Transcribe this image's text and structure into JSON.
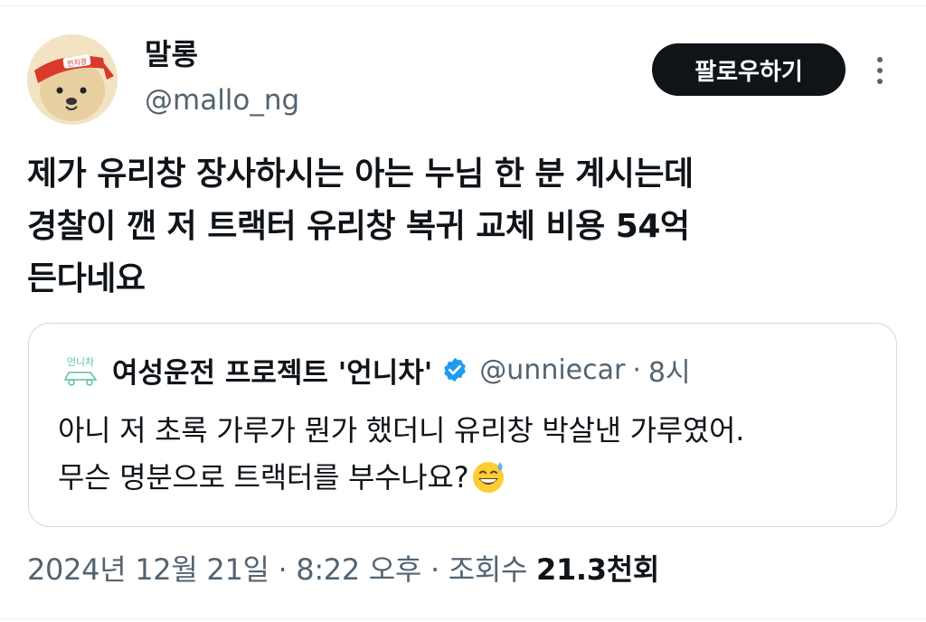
{
  "author": {
    "name": "말롱",
    "handle": "@mallo_ng",
    "avatar_badge_text": "먼지킁"
  },
  "follow_button_label": "팔로우하기",
  "tweet": {
    "lines": [
      "제가 유리창 장사하시는 아는 누님 한 분 계시는데",
      "경찰이 깬 저 트랙터 유리창 복귀 교체 비용 54억",
      "든다네요"
    ]
  },
  "quote": {
    "avatar_text": "언니차",
    "name": "여성운전 프로젝트 '언니차'",
    "handle": "@unniecar",
    "separator": "·",
    "time": "8시",
    "lines": [
      "아니 저 초록 가루가 뭔가 했더니 유리창 박살낸 가루였어.",
      "무슨 명분으로 트랙터를 부수나요?"
    ],
    "emoji": "grinning-face-with-sweat"
  },
  "meta": {
    "date": "2024년 12월 21일",
    "sep1": " · ",
    "time": "8:22 오후",
    "sep2": " · ",
    "views_label": "조회수 ",
    "views_count": "21.3천회"
  },
  "colors": {
    "text": "#0f1419",
    "secondary": "#536471",
    "verified": "#1d9bf0",
    "border": "#cfd9de"
  }
}
